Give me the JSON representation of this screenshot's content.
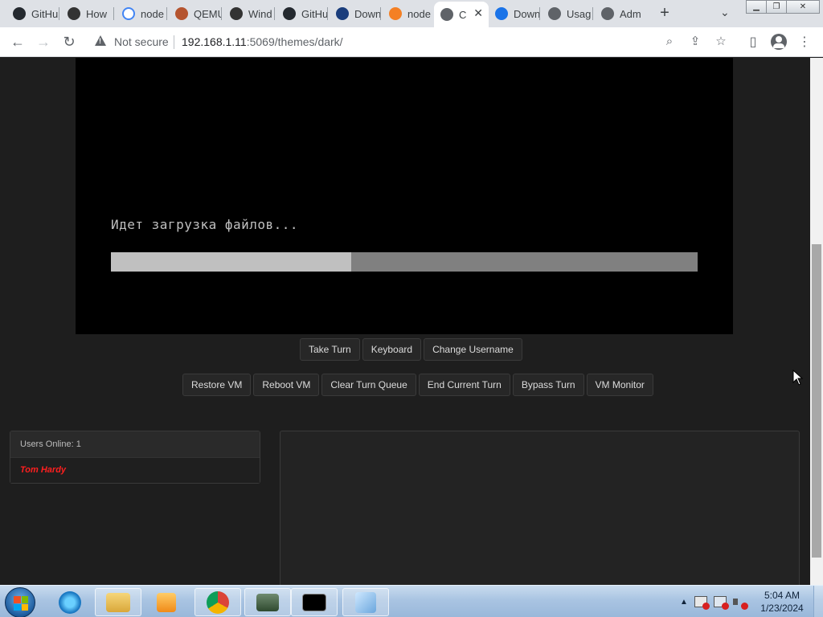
{
  "browser": {
    "tabs": [
      {
        "title": "GitHub",
        "icon": "github-icon"
      },
      {
        "title": "How",
        "icon": "page-icon"
      },
      {
        "title": "node",
        "icon": "google-icon"
      },
      {
        "title": "QEMU",
        "icon": "qemu-icon"
      },
      {
        "title": "Wind",
        "icon": "bank-icon"
      },
      {
        "title": "GitHub",
        "icon": "github-icon"
      },
      {
        "title": "Down",
        "icon": "n-icon"
      },
      {
        "title": "node",
        "icon": "stackoverflow-icon"
      },
      {
        "title": "C",
        "icon": "globe-icon"
      },
      {
        "title": "Down",
        "icon": "download-icon"
      },
      {
        "title": "Usag",
        "icon": "docs-icon"
      },
      {
        "title": "Adm",
        "icon": "globe-icon"
      }
    ],
    "security_label": "Not secure",
    "url_host": "192.168.1.11",
    "url_rest": ":5069/themes/dark/"
  },
  "vm": {
    "screen_text": "Идет загрузка файлов...",
    "progress_fraction": 0.41
  },
  "controls": {
    "row1": [
      "Take Turn",
      "Keyboard",
      "Change Username"
    ],
    "row2": [
      "Restore VM",
      "Reboot VM",
      "Clear Turn Queue",
      "End Current Turn",
      "Bypass Turn",
      "VM Monitor"
    ]
  },
  "users": {
    "header": "Users Online: 1",
    "list": [
      "Tom Hardy"
    ]
  },
  "taskbar": {
    "time": "5:04 AM",
    "date": "1/23/2024",
    "apps": [
      "ie-icon",
      "explorer-icon",
      "media-player-icon",
      "chrome-icon",
      "network-app-icon",
      "cmd-icon",
      "notepad-icon"
    ]
  },
  "colors": {
    "page_bg": "#1e1e1e",
    "admin_user": "#ff1f1f",
    "vm_text": "#c0c0c0"
  }
}
